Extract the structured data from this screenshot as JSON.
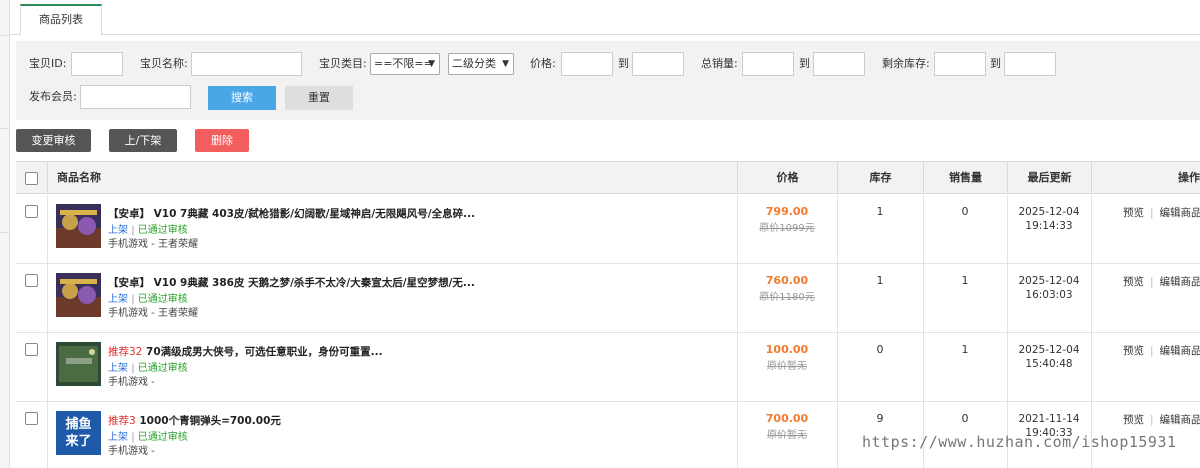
{
  "tabs": [
    {
      "label": "商品列表"
    }
  ],
  "search": {
    "id_label": "宝贝ID:",
    "name_label": "宝贝名称:",
    "category_label": "宝贝类目:",
    "category_value": "==不限==",
    "subcategory_value": "二级分类",
    "price_label": "价格:",
    "to_label": "到",
    "sales_label": "总销量:",
    "stock_label": "剩余库存:",
    "member_label": "发布会员:",
    "search_button": "搜索",
    "reset_button": "重置"
  },
  "actions": {
    "change_review": "变更审核",
    "toggle_shelf": "上/下架",
    "delete": "删除"
  },
  "table": {
    "headers": {
      "name": "商品名称",
      "price": "价格",
      "stock": "库存",
      "sales": "销售量",
      "updated": "最后更新",
      "ops": "操作"
    },
    "rows": [
      {
        "recommend": "",
        "title": "【安卓】 V10 7典藏 403皮/弑枪猎影/幻阔歌/星域神启/无限飓风号/全息碎...",
        "up": "上架",
        "sep": "|",
        "review": "已通过审核",
        "category": "手机游戏 - 王者荣耀",
        "price": "799.00",
        "orig_price": "原价1099元",
        "stock": "1",
        "sales": "0",
        "date": "2025-12-04",
        "time": "19:14:33",
        "preview": "预览",
        "edit": "编辑商品",
        "thumb": "game"
      },
      {
        "recommend": "",
        "title": "【安卓】 V10 9典藏 386皮 天鹅之梦/杀手不太冷/大秦宣太后/星空梦想/无...",
        "up": "上架",
        "sep": "|",
        "review": "已通过审核",
        "category": "手机游戏 - 王者荣耀",
        "price": "760.00",
        "orig_price": "原价1180元",
        "stock": "1",
        "sales": "1",
        "date": "2025-12-04",
        "time": "16:03:03",
        "preview": "预览",
        "edit": "编辑商品",
        "thumb": "game"
      },
      {
        "recommend": "推荐32",
        "title": "70满级成男大侠号，可选任意职业，身份可重置...",
        "up": "上架",
        "sep": "|",
        "review": "已通过审核",
        "category": "手机游戏 -",
        "price": "100.00",
        "orig_price": "原价暂无",
        "stock": "0",
        "sales": "1",
        "date": "2025-12-04",
        "time": "15:40:48",
        "preview": "预览",
        "edit": "编辑商品",
        "thumb": "map"
      },
      {
        "recommend": "推荐3",
        "title": "1000个青铜弹头=700.00元",
        "up": "上架",
        "sep": "|",
        "review": "已通过审核",
        "category": "手机游戏 -",
        "price": "700.00",
        "orig_price": "原价暂无",
        "stock": "9",
        "sales": "0",
        "date": "2021-11-14",
        "time": "19:40:33",
        "preview": "预览",
        "edit": "编辑商品",
        "thumb": "fish",
        "thumb_text_1": "捕鱼",
        "thumb_text_2": "来了"
      }
    ]
  },
  "watermark": "https://www.huzhan.com/ishop15931",
  "colors": {
    "accent": "#49a7e7",
    "price": "#f07b2f",
    "delete": "#f25e5e",
    "approved": "#2ba02b",
    "on_shelf": "#2c6fd6"
  }
}
